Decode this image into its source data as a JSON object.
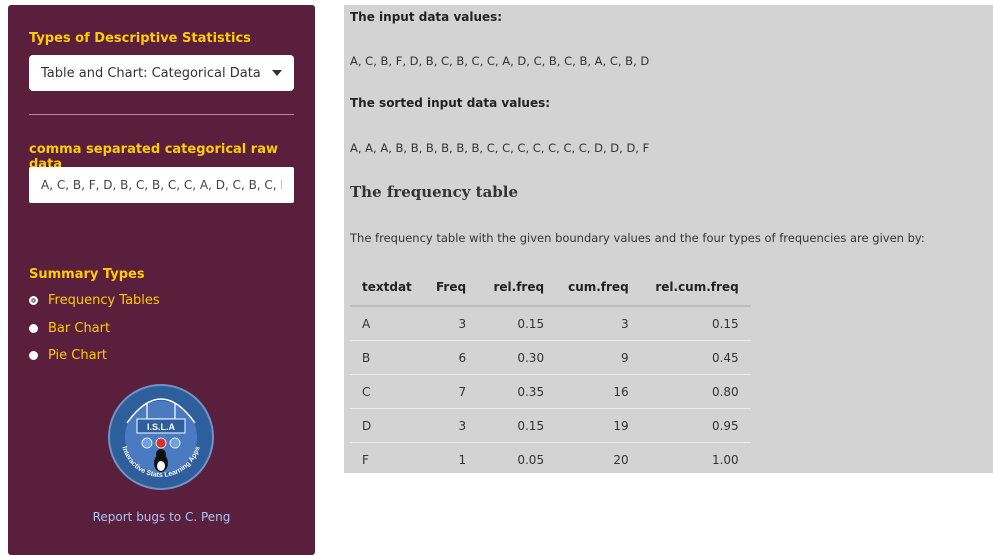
{
  "sidebar": {
    "types_heading": "Types of Descriptive Statistics",
    "types_selected": "Table and Chart: Categorical Data",
    "raw_data_heading": "comma separated categorical raw data",
    "raw_data_value": "A, C, B, F, D, B, C, B, C, C, A, D, C, B, C, B, A, C, B, D",
    "summary_heading": "Summary Types",
    "summary_options": [
      {
        "label": "Frequency Tables",
        "checked": true
      },
      {
        "label": "Bar Chart",
        "checked": false
      },
      {
        "label": "Pie Chart",
        "checked": false
      }
    ],
    "logo": {
      "text": "I.S.L.A",
      "ring_text": "Interactive Stats Learning Apps"
    },
    "report_link": "Report bugs to C. Peng"
  },
  "main": {
    "input_label": "The input data values:",
    "input_values": "A, C, B, F, D, B, C, B, C, C, A, D, C, B, C, B, A, C, B, D",
    "sorted_label": "The sorted input data values:",
    "sorted_values": "A, A, A, B, B, B, B, B, B, C, C, C, C, C, C, C, D, D, D, F",
    "table_title": "The frequency table",
    "table_desc": "The frequency table with the given boundary values and the four types of frequencies are given by:",
    "table": {
      "headers": [
        "textdat",
        "Freq",
        "rel.freq",
        "cum.freq",
        "rel.cum.freq"
      ],
      "rows": [
        [
          "A",
          "3",
          "0.15",
          "3",
          "0.15"
        ],
        [
          "B",
          "6",
          "0.30",
          "9",
          "0.45"
        ],
        [
          "C",
          "7",
          "0.35",
          "16",
          "0.80"
        ],
        [
          "D",
          "3",
          "0.15",
          "19",
          "0.95"
        ],
        [
          "F",
          "1",
          "0.05",
          "20",
          "1.00"
        ]
      ]
    }
  },
  "colors": {
    "sidebar_bg": "#5a1f3d",
    "heading": "#ffcc00",
    "main_bg": "#d3d3d3",
    "link": "#a9c6f5"
  }
}
